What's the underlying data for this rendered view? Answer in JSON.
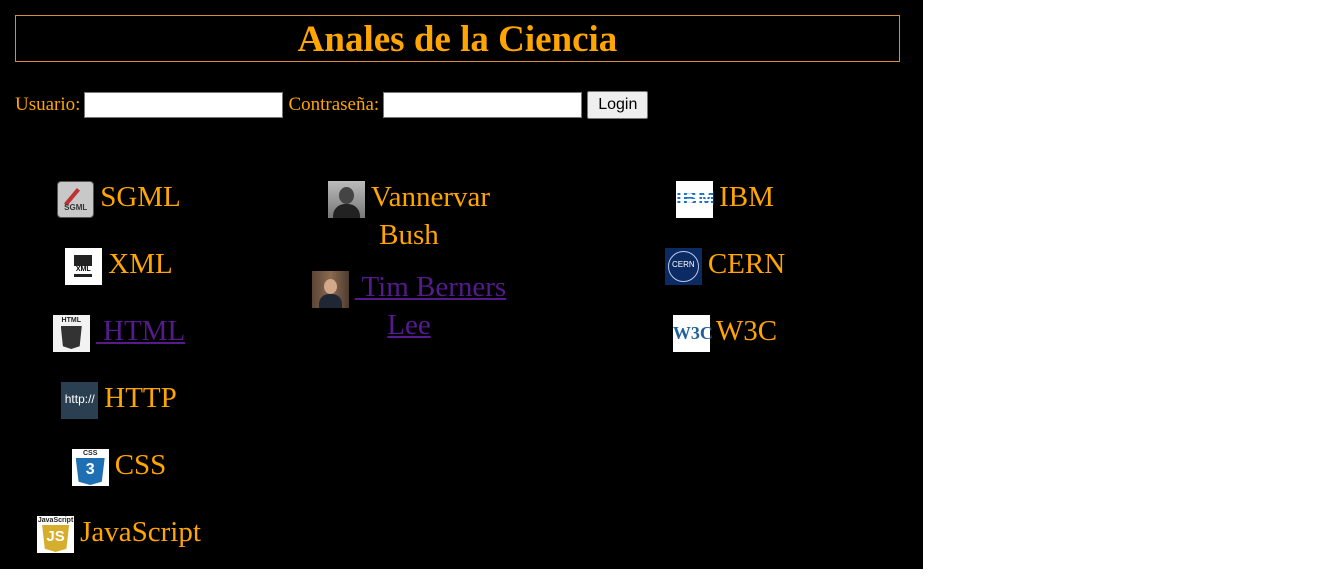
{
  "header": {
    "title": "Anales de la Ciencia"
  },
  "login": {
    "user_label": "Usuario:",
    "user_value": "",
    "password_label": "Contraseña:",
    "password_value": "",
    "button_label": "Login"
  },
  "columns": {
    "technologies": [
      {
        "label": "SGML",
        "icon": "sgml-icon",
        "icon_text": "SGML",
        "link": false
      },
      {
        "label": "XML",
        "icon": "xml-icon",
        "icon_text": "XML",
        "link": false
      },
      {
        "label": " HTML",
        "icon": "html5-icon",
        "icon_text": "HTML",
        "link": true
      },
      {
        "label": "HTTP",
        "icon": "http-icon",
        "icon_text": "http://",
        "link": false
      },
      {
        "label": "CSS",
        "icon": "css3-icon",
        "icon_text": "CSS",
        "icon_number": "3",
        "link": false
      },
      {
        "label": "JavaScript",
        "icon": "javascript-icon",
        "icon_text": "JavaScript",
        "icon_number": "JS",
        "link": false
      }
    ],
    "people": [
      {
        "label": "Vannervar Bush",
        "icon": "vannevar-bush-photo",
        "link": false
      },
      {
        "label": " Tim Berners Lee",
        "icon": "tim-berners-lee-photo",
        "link": true
      }
    ],
    "organizations": [
      {
        "label": "IBM",
        "icon": "ibm-logo-icon",
        "icon_text": "IBM",
        "link": false
      },
      {
        "label": "CERN",
        "icon": "cern-logo-icon",
        "icon_text": "CERN",
        "link": false
      },
      {
        "label": "W3C",
        "icon": "w3c-logo-icon",
        "icon_text": "W3C",
        "link": false
      }
    ]
  },
  "colors": {
    "page_background": "#000000",
    "text_accent": "#ffa500",
    "link_visited": "#551a8b",
    "title_border": "#d98c3a"
  }
}
